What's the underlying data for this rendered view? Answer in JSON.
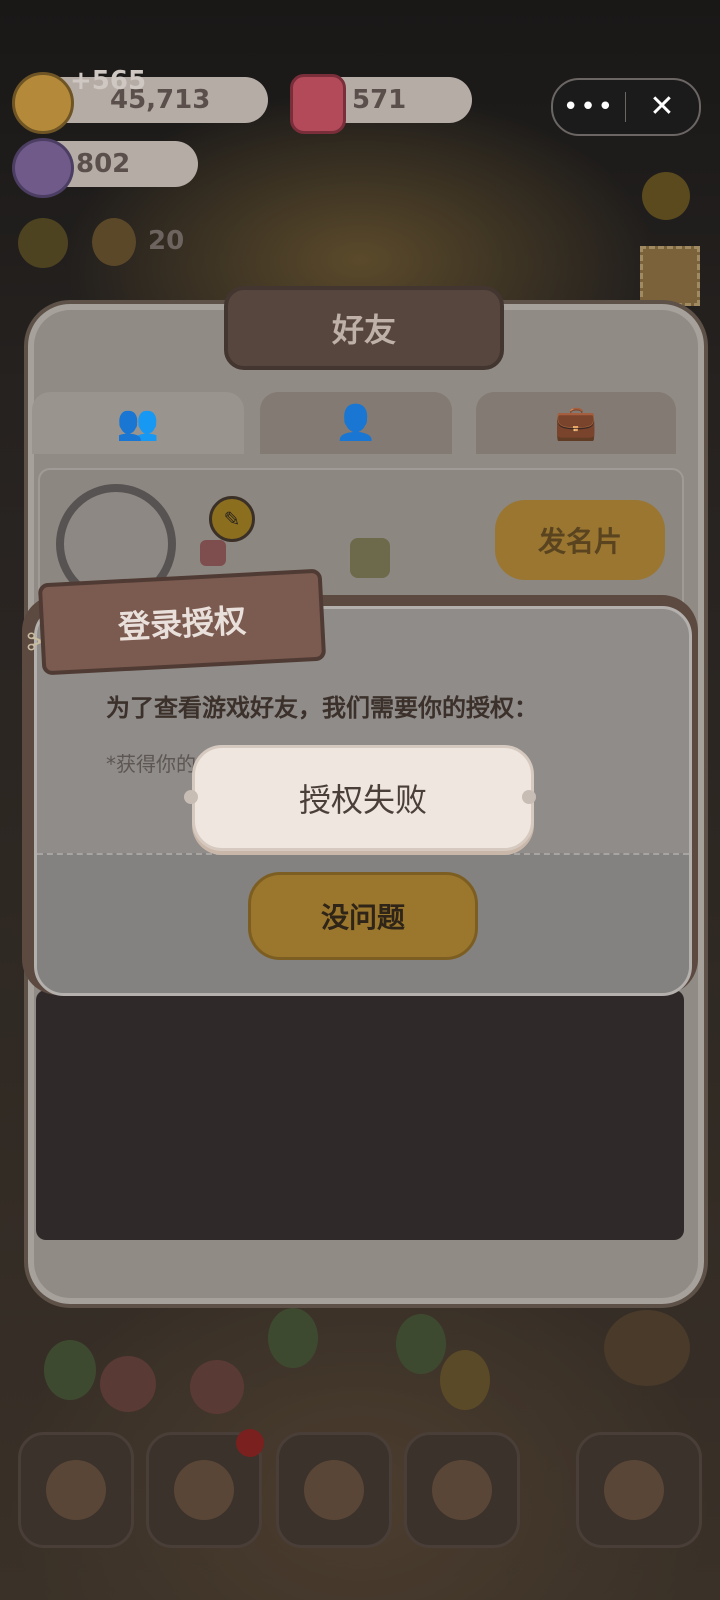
{
  "hud": {
    "coins": "45,713",
    "coin_gain": "+565",
    "jelly": "571",
    "candy": "802",
    "helpers": "20"
  },
  "capsule": {
    "more": "•••",
    "close": "✕"
  },
  "friends_panel": {
    "title": "好友",
    "tabs": [
      {
        "name": "friends-list"
      },
      {
        "name": "add-friend"
      },
      {
        "name": "bag"
      }
    ],
    "send_card_label": "发名片"
  },
  "auth_modal": {
    "title": "登录授权",
    "message": "为了查看游戏好友，我们需要你的授权：",
    "sub_text": "*获得你的",
    "ok_label": "没问题"
  },
  "toast": {
    "text": "授权失败"
  }
}
